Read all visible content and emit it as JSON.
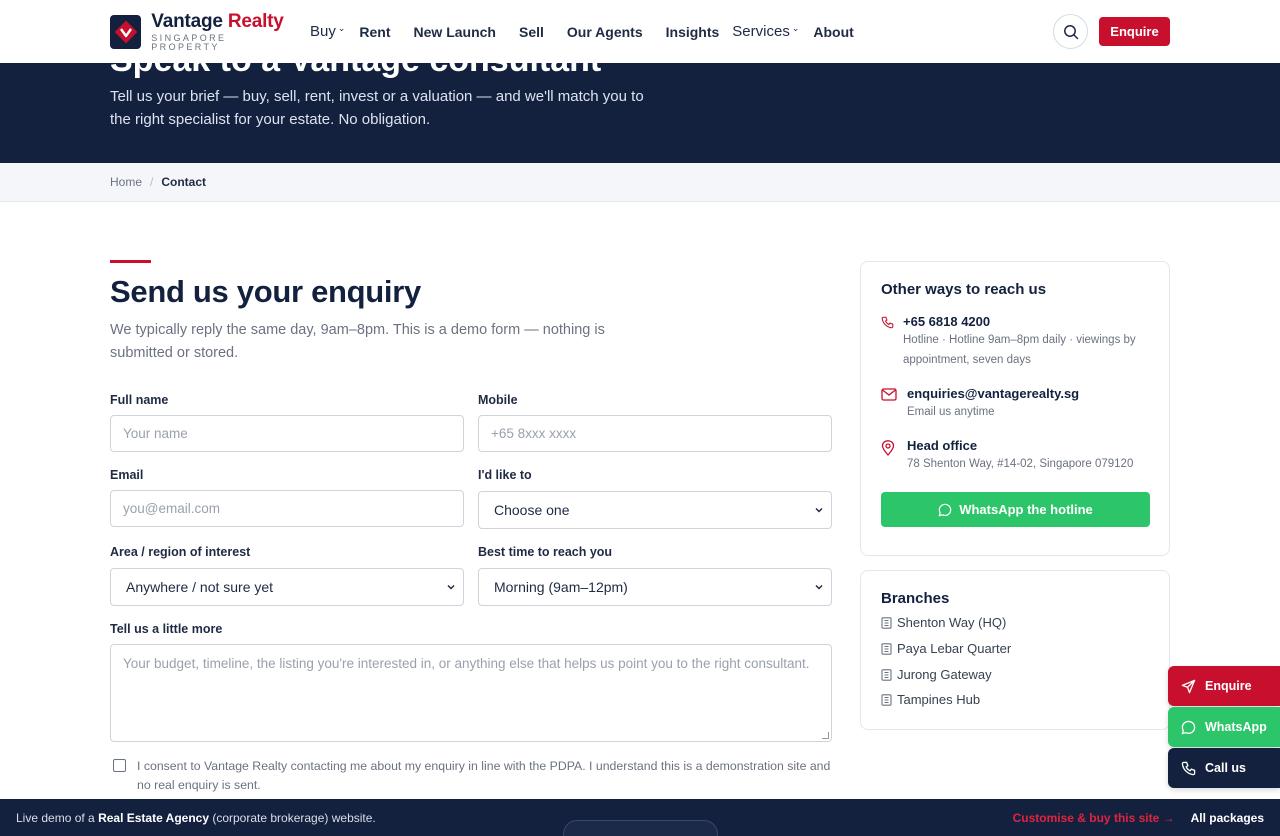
{
  "brand": {
    "name_main": "Vantage",
    "name_accent": "Realty",
    "tagline": "SINGAPORE PROPERTY",
    "colors": {
      "navy": "#13213f",
      "red": "#c8102e",
      "green": "#2cc56a"
    }
  },
  "nav": {
    "items": [
      {
        "label": "Buy",
        "has_dropdown": true
      },
      {
        "label": "Rent"
      },
      {
        "label": "New Launch"
      },
      {
        "label": "Sell"
      },
      {
        "label": "Our Agents"
      },
      {
        "label": "Insights"
      },
      {
        "label": "Services",
        "has_dropdown": true
      },
      {
        "label": "About"
      }
    ],
    "enquire_label": "Enquire"
  },
  "hero": {
    "title": "Speak to a Vantage consultant",
    "description": "Tell us your brief — buy, sell, rent, invest or a valuation — and we'll match you to the right specialist for your estate. No obligation."
  },
  "breadcrumb": {
    "home": "Home",
    "separator": "/",
    "current": "Contact"
  },
  "form": {
    "title": "Send us your enquiry",
    "intro": "We typically reply the same day, 9am–8pm. This is a demo form — nothing is submitted or stored.",
    "full_name": {
      "label": "Full name",
      "placeholder": "Your name"
    },
    "mobile": {
      "label": "Mobile",
      "placeholder": "+65 8xxx xxxx"
    },
    "email": {
      "label": "Email",
      "placeholder": "you@email.com"
    },
    "intent": {
      "label": "I'd like to",
      "value": "Choose one"
    },
    "area": {
      "label": "Area / region of interest",
      "value": "Anywhere / not sure yet"
    },
    "best_time": {
      "label": "Best time to reach you",
      "value": "Morning (9am–12pm)"
    },
    "message": {
      "label": "Tell us a little more",
      "placeholder": "Your budget, timeline, the listing you're interested in, or anything else that helps us point you to the right consultant."
    },
    "consent": "I consent to Vantage Realty contacting me about my enquiry in line with the PDPA. I understand this is a demonstration site and no real enquiry is sent."
  },
  "sidebar": {
    "reach": {
      "title": "Other ways to reach us",
      "phone": {
        "main": "+65 6818 4200",
        "sub": "Hotline · Hotline 9am–8pm daily · viewings by appointment, seven days",
        "icon": "phone-icon"
      },
      "email": {
        "main": "enquiries@vantagerealty.sg",
        "sub": "Email us anytime",
        "icon": "mail-icon"
      },
      "office": {
        "main": "Head office",
        "sub": "78 Shenton Way, #14-02, Singapore 079120",
        "icon": "map-pin-icon"
      },
      "whatsapp_label": "WhatsApp the hotline"
    },
    "branches": {
      "title": "Branches",
      "items": [
        "Shenton Way (HQ)",
        "Paya Lebar Quarter",
        "Jurong Gateway",
        "Tampines Hub"
      ]
    }
  },
  "floating": {
    "enquire": "Enquire",
    "whatsapp": "WhatsApp",
    "call": "Call us"
  },
  "demo_bar": {
    "prefix": "Live demo of a",
    "bold": "Real Estate Agency",
    "suffix": "(corporate brokerage) website.",
    "customise": "Customise & buy this site →",
    "all_packages": "All packages"
  }
}
